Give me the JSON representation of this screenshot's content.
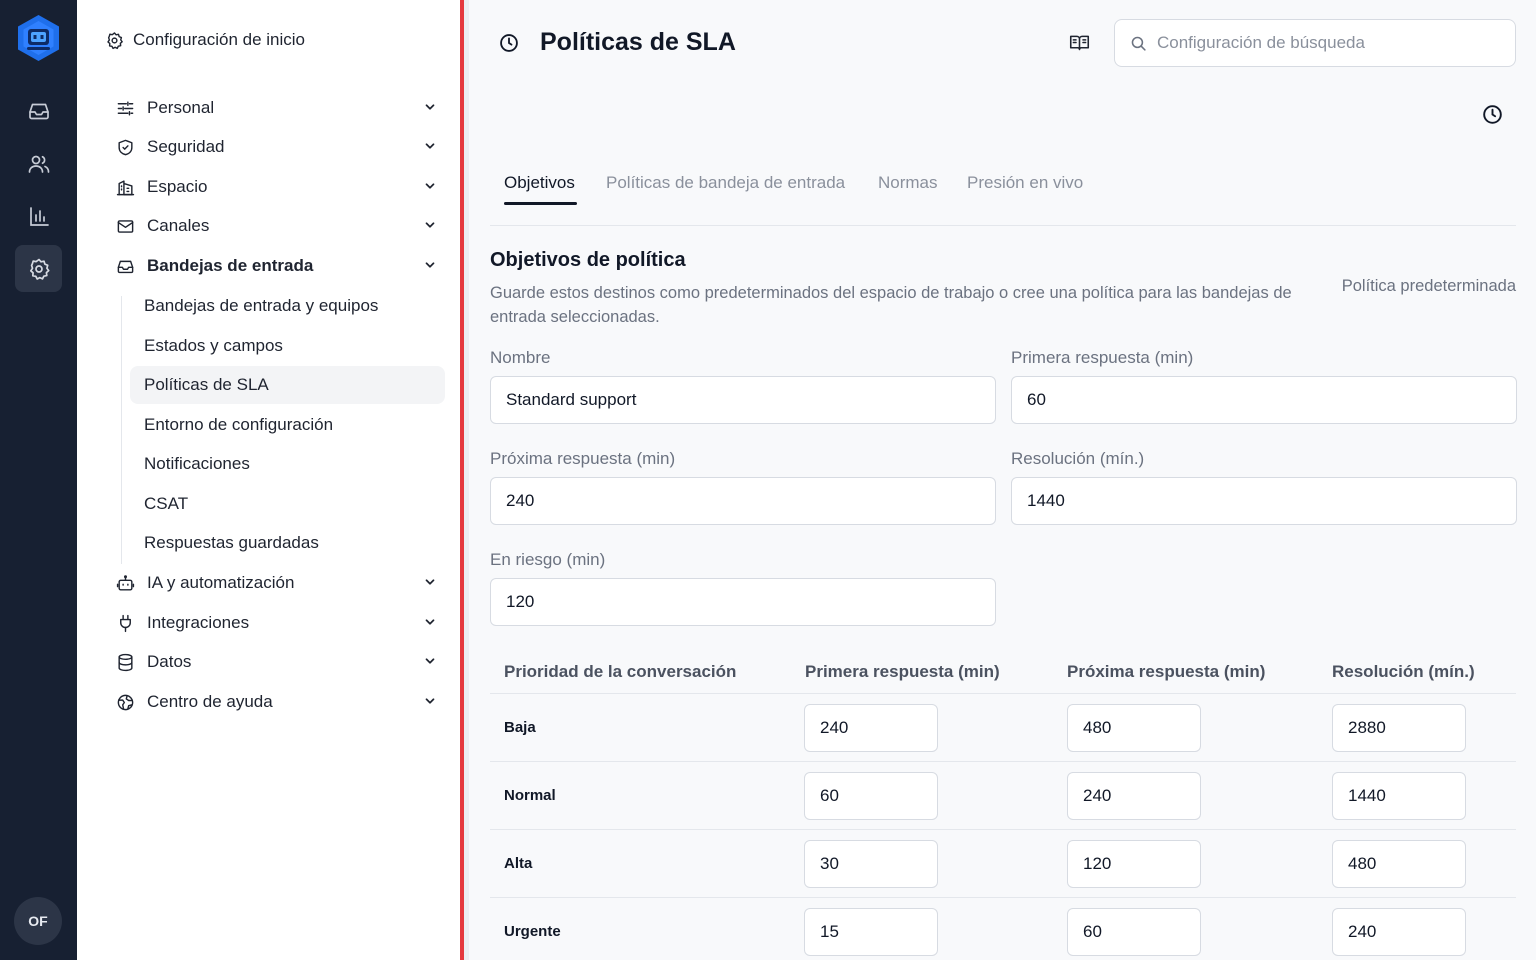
{
  "rail": {
    "items": [
      "inbox-icon",
      "users-icon",
      "bar-chart-icon",
      "settings-icon"
    ],
    "avatar_initials": "OF"
  },
  "sidebar": {
    "header": "Configuración de inicio",
    "items": [
      {
        "label": "Personal",
        "icon": "sliders-icon"
      },
      {
        "label": "Seguridad",
        "icon": "shield-icon"
      },
      {
        "label": "Espacio",
        "icon": "building-icon"
      },
      {
        "label": "Canales",
        "icon": "mail-icon"
      },
      {
        "label": "Bandejas de entrada",
        "icon": "inbox-icon"
      },
      {
        "label": "IA y automatización",
        "icon": "robot-icon"
      },
      {
        "label": "Integraciones",
        "icon": "plug-icon"
      },
      {
        "label": "Datos",
        "icon": "database-icon"
      },
      {
        "label": "Centro de ayuda",
        "icon": "globe-icon"
      }
    ],
    "subitems": [
      "Bandejas de entrada y equipos",
      "Estados y campos",
      "Políticas de SLA",
      "Entorno de configuración",
      "Notificaciones",
      "CSAT",
      "Respuestas guardadas"
    ]
  },
  "header": {
    "title": "Políticas de SLA",
    "search_placeholder": "Configuración de búsqueda"
  },
  "tabs": [
    "Objetivos",
    "Políticas de bandeja de entrada",
    "Normas",
    "Presión en vivo"
  ],
  "section": {
    "title": "Objetivos de política",
    "description": "Guarde estos destinos como predeterminados del espacio de trabajo o cree una política para las bandejas de entrada seleccionadas.",
    "link": "Política predeterminada"
  },
  "form": {
    "name_label": "Nombre",
    "name_value": "Standard support",
    "first_label": "Primera respuesta (min)",
    "first_value": "60",
    "next_label": "Próxima respuesta (min)",
    "next_value": "240",
    "resolution_label": "Resolución (mín.)",
    "resolution_value": "1440",
    "risk_label": "En riesgo (min)",
    "risk_value": "120"
  },
  "table": {
    "headers": [
      "Prioridad de la conversación",
      "Primera respuesta (min)",
      "Próxima respuesta (min)",
      "Resolución (mín.)"
    ],
    "rows": [
      {
        "priority": "Baja",
        "first": "240",
        "next": "480",
        "resolution": "2880"
      },
      {
        "priority": "Normal",
        "first": "60",
        "next": "240",
        "resolution": "1440"
      },
      {
        "priority": "Alta",
        "first": "30",
        "next": "120",
        "resolution": "480"
      },
      {
        "priority": "Urgente",
        "first": "15",
        "next": "60",
        "resolution": "240"
      }
    ]
  },
  "colors": {
    "rail_bg": "#172032",
    "accent_divider": "#e5393e",
    "logo_blue": "#1f6feb"
  }
}
